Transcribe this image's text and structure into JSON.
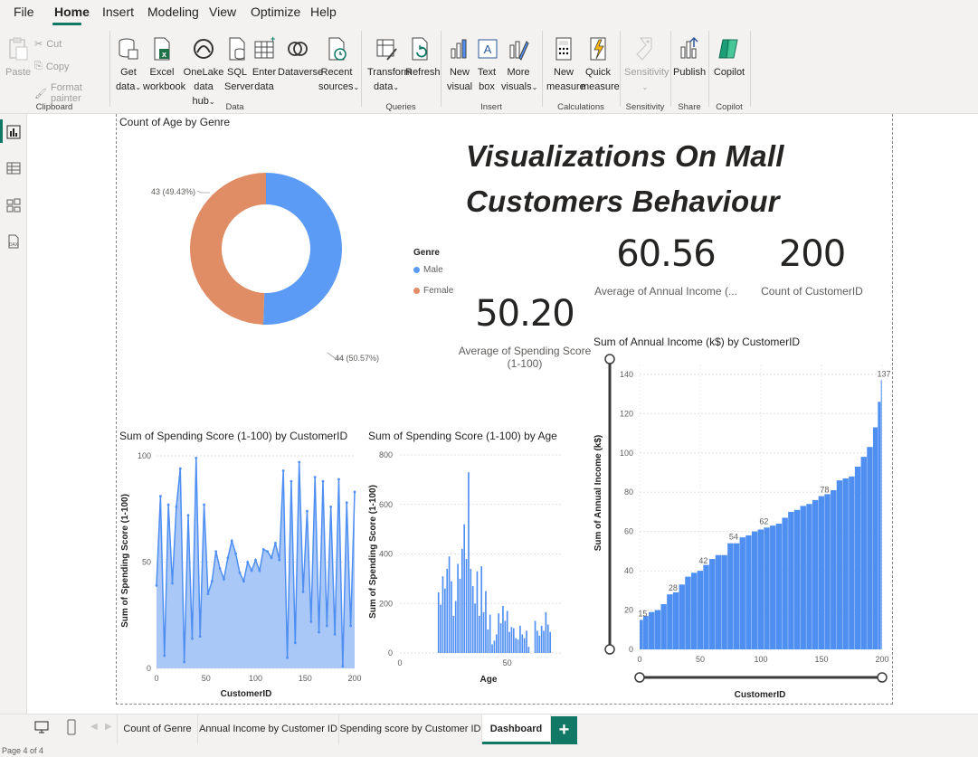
{
  "menu": [
    "File",
    "Home",
    "Insert",
    "Modeling",
    "View",
    "Optimize",
    "Help"
  ],
  "ribbon": {
    "clipboard": {
      "paste": "Paste",
      "cut": "Cut",
      "copy": "Copy",
      "format_painter": "Format painter",
      "label": "Clipboard"
    },
    "data": {
      "get_data": [
        "Get",
        "data"
      ],
      "excel": [
        "Excel",
        "workbook"
      ],
      "onelake": [
        "OneLake",
        "data hub"
      ],
      "sql": [
        "SQL",
        "Server"
      ],
      "enter": [
        "Enter",
        "data"
      ],
      "dataverse": "Dataverse",
      "recent": [
        "Recent",
        "sources"
      ],
      "label": "Data"
    },
    "queries": {
      "transform": [
        "Transform",
        "data"
      ],
      "refresh": "Refresh",
      "label": "Queries"
    },
    "insert": {
      "new_visual": [
        "New",
        "visual"
      ],
      "text_box": [
        "Text",
        "box"
      ],
      "more_visuals": [
        "More",
        "visuals"
      ],
      "label": "Insert"
    },
    "calculations": {
      "new_measure": [
        "New",
        "measure"
      ],
      "quick_measure": [
        "Quick",
        "measure"
      ],
      "label": "Calculations"
    },
    "sensitivity": {
      "btn": "Sensitivity",
      "label": "Sensitivity"
    },
    "share": {
      "publish": "Publish",
      "label": "Share"
    },
    "copilot": {
      "btn": "Copilot",
      "label": "Copilot"
    }
  },
  "report": {
    "title": "Visualizations On Mall Customers Behaviour",
    "cards": [
      {
        "value": "60.56",
        "label": "Average of Annual Income (..."
      },
      {
        "value": "200",
        "label": "Count of CustomerID"
      },
      {
        "value": "50.20",
        "label_line1": "Average of Spending Score",
        "label_line2": "(1-100)"
      }
    ]
  },
  "colors": {
    "male": "#5b9bf5",
    "female": "#e08c64",
    "accent": "#117865",
    "bar": "#4f8ff2"
  },
  "chart_data": [
    {
      "type": "pie",
      "title": "Count of Age by Genre",
      "legend_title": "Genre",
      "legend_position": "right",
      "categories": [
        "Male",
        "Female"
      ],
      "values": [
        44,
        43
      ],
      "data_labels": [
        "44 (50.57%)",
        "43 (49.43%)"
      ]
    },
    {
      "type": "area",
      "title": "Sum of Spending Score (1-100) by CustomerID",
      "xlabel": "CustomerID",
      "ylabel": "Sum of Spending Score (1-100)",
      "x_ticks": [
        "0",
        "50",
        "100",
        "150",
        "200"
      ],
      "y_ticks": [
        "0",
        "50",
        "100"
      ],
      "xlim": [
        0,
        200
      ],
      "ylim": [
        0,
        100
      ],
      "x": [
        0,
        4,
        8,
        12,
        16,
        20,
        24,
        28,
        32,
        36,
        40,
        44,
        48,
        52,
        56,
        60,
        64,
        68,
        72,
        76,
        80,
        84,
        88,
        92,
        96,
        100,
        104,
        108,
        112,
        116,
        120,
        124,
        128,
        132,
        136,
        140,
        144,
        148,
        152,
        156,
        160,
        164,
        168,
        172,
        176,
        180,
        184,
        188,
        192,
        196,
        200
      ],
      "values": [
        39,
        81,
        6,
        77,
        40,
        76,
        94,
        3,
        72,
        14,
        99,
        15,
        77,
        35,
        41,
        55,
        47,
        42,
        52,
        60,
        54,
        45,
        41,
        50,
        46,
        51,
        46,
        56,
        55,
        52,
        59,
        51,
        93,
        5,
        88,
        12,
        97,
        36,
        74,
        22,
        90,
        17,
        88,
        20,
        76,
        16,
        89,
        1,
        78,
        20,
        83
      ]
    },
    {
      "type": "bar",
      "title": "Sum of Spending Score (1-100) by Age",
      "xlabel": "Age",
      "ylabel": "Sum of Spending Score (1-100)",
      "x_ticks": [
        "0",
        "50"
      ],
      "y_ticks": [
        "0",
        "200",
        "400",
        "600",
        "800"
      ],
      "xlim": [
        0,
        75
      ],
      "ylim": [
        0,
        800
      ],
      "x": [
        18,
        19,
        20,
        21,
        22,
        23,
        24,
        25,
        26,
        27,
        28,
        29,
        30,
        31,
        32,
        33,
        34,
        35,
        36,
        37,
        38,
        39,
        40,
        41,
        42,
        43,
        44,
        45,
        46,
        47,
        48,
        49,
        50,
        51,
        52,
        53,
        54,
        55,
        56,
        57,
        58,
        59,
        60,
        63,
        64,
        65,
        66,
        67,
        68,
        69,
        70
      ],
      "values": [
        245,
        195,
        310,
        260,
        340,
        390,
        290,
        150,
        210,
        360,
        300,
        420,
        520,
        380,
        730,
        340,
        270,
        200,
        330,
        150,
        350,
        165,
        250,
        95,
        155,
        35,
        50,
        75,
        160,
        120,
        190,
        130,
        170,
        85,
        105,
        100,
        60,
        55,
        110,
        75,
        60,
        90,
        25,
        130,
        90,
        70,
        110,
        90,
        165,
        115,
        85
      ]
    },
    {
      "type": "bar",
      "title": "Sum of Annual Income (k$) by CustomerID",
      "xlabel": "CustomerID",
      "ylabel": "Sum of Annual Income (k$)",
      "x_ticks": [
        "0",
        "50",
        "100",
        "150",
        "200"
      ],
      "y_ticks": [
        "0",
        "20",
        "40",
        "60",
        "80",
        "100",
        "120",
        "140"
      ],
      "xlim": [
        0,
        200
      ],
      "ylim": [
        0,
        145
      ],
      "annotations": [
        {
          "x": 1,
          "y": 15
        },
        {
          "x": 26,
          "y": 28
        },
        {
          "x": 51,
          "y": 42
        },
        {
          "x": 76,
          "y": 54
        },
        {
          "x": 101,
          "y": 62
        },
        {
          "x": 151,
          "y": 78
        },
        {
          "x": 200,
          "y": 137
        }
      ],
      "x": [
        1,
        5,
        10,
        15,
        20,
        25,
        30,
        35,
        40,
        45,
        50,
        55,
        60,
        65,
        70,
        75,
        80,
        85,
        90,
        95,
        100,
        105,
        110,
        115,
        120,
        125,
        130,
        135,
        140,
        145,
        150,
        155,
        160,
        165,
        170,
        175,
        180,
        185,
        190,
        195,
        198,
        200
      ],
      "values": [
        15,
        17,
        19,
        20,
        23,
        28,
        29,
        33,
        37,
        39,
        40,
        43,
        46,
        48,
        48,
        54,
        54,
        57,
        58,
        60,
        61,
        62,
        63,
        64,
        67,
        70,
        71,
        73,
        74,
        76,
        78,
        79,
        81,
        86,
        87,
        88,
        93,
        98,
        103,
        113,
        126,
        137
      ]
    }
  ],
  "tabs": [
    "Count of Genre",
    "Annual Income by Customer ID",
    "Spending score by Customer ID",
    "Dashboard"
  ],
  "add_tab": "+",
  "status": "Page 4 of 4"
}
